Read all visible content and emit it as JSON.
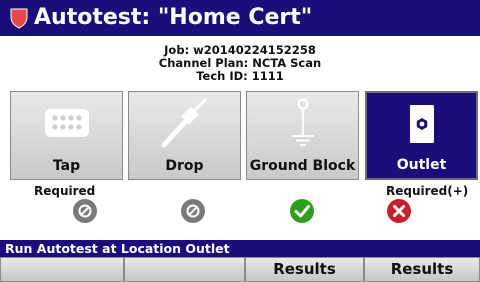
{
  "header": {
    "title": "Autotest: \"Home Cert\""
  },
  "info": {
    "job": "Job: w20140224152258",
    "channel_plan": "Channel Plan: NCTA Scan",
    "tech_id": "Tech ID: 1111"
  },
  "locations": [
    {
      "label": "Tap",
      "icon": "tap-icon",
      "requirement": "Required",
      "status": "skipped",
      "selected": false
    },
    {
      "label": "Drop",
      "icon": "drop-cable-icon",
      "requirement": "",
      "status": "skipped",
      "selected": false
    },
    {
      "label": "Ground Block",
      "icon": "ground-block-icon",
      "requirement": "",
      "status": "passed",
      "selected": false
    },
    {
      "label": "Outlet",
      "icon": "outlet-icon",
      "requirement": "Required(+)",
      "status": "failed",
      "selected": true
    }
  ],
  "status_bar": {
    "text": "Run Autotest at Location Outlet"
  },
  "softkeys": [
    "",
    "",
    "Results",
    "Results"
  ],
  "colors": {
    "brand_blue": "#1a0f7a",
    "pass_green": "#2f9e1c",
    "fail_red": "#c8202a",
    "skip_gray": "#7a7a7a"
  }
}
